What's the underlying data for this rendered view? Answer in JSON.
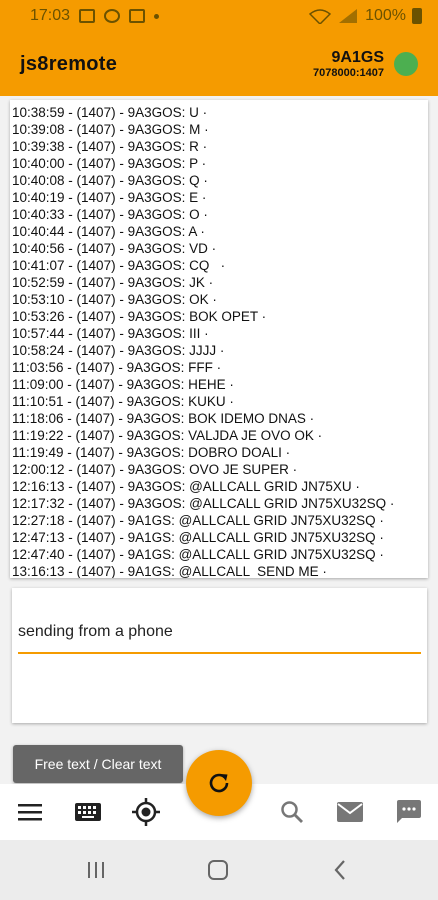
{
  "status_bar": {
    "time": "17:03",
    "battery": "100%"
  },
  "app_bar": {
    "title": "js8remote",
    "callsign": "9A1GS",
    "frequency": "7078000:1407"
  },
  "log": [
    "10:38:59 - (1407) - 9A3GOS: U ·",
    "10:39:08 - (1407) - 9A3GOS: M ·",
    "10:39:38 - (1407) - 9A3GOS: R ·",
    "10:40:00 - (1407) - 9A3GOS: P ·",
    "10:40:08 - (1407) - 9A3GOS: Q ·",
    "10:40:19 - (1407) - 9A3GOS: E ·",
    "10:40:33 - (1407) - 9A3GOS: O ·",
    "10:40:44 - (1407) - 9A3GOS: A ·",
    "10:40:56 - (1407) - 9A3GOS: VD ·",
    "10:41:07 - (1407) - 9A3GOS: CQ   ·",
    "10:52:59 - (1407) - 9A3GOS: JK ·",
    "10:53:10 - (1407) - 9A3GOS: OK ·",
    "10:53:26 - (1407) - 9A3GOS: BOK OPET ·",
    "10:57:44 - (1407) - 9A3GOS: III ·",
    "10:58:24 - (1407) - 9A3GOS: JJJJ ·",
    "11:03:56 - (1407) - 9A3GOS: FFF ·",
    "11:09:00 - (1407) - 9A3GOS: HEHE ·",
    "11:10:51 - (1407) - 9A3GOS: KUKU ·",
    "11:18:06 - (1407) - 9A3GOS: BOK IDEMO DNAS ·",
    "11:19:22 - (1407) - 9A3GOS: VALJDA JE OVO OK ·",
    "11:19:49 - (1407) - 9A3GOS: DOBRO DOALI ·",
    "12:00:12 - (1407) - 9A3GOS: OVO JE SUPER ·",
    "12:16:13 - (1407) - 9A3GOS: @ALLCALL GRID JN75XU ·",
    "12:17:32 - (1407) - 9A3GOS: @ALLCALL GRID JN75XU32SQ ·",
    "12:27:18 - (1407) - 9A1GS: @ALLCALL GRID JN75XU32SQ ·",
    "12:47:13 - (1407) - 9A1GS: @ALLCALL GRID JN75XU32SQ ·",
    "12:47:40 - (1407) - 9A1GS: @ALLCALL GRID JN75XU32SQ ·",
    "13:16:13 - (1407) - 9A1GS: @ALLCALL  SEND ME ·"
  ],
  "input": {
    "value": "sending from a phone"
  },
  "buttons": {
    "free_text": "Free text / Clear text"
  },
  "colors": {
    "accent": "#f59b00",
    "status_online": "#4caf50",
    "button_gray": "#666666"
  },
  "icons": {
    "fab": "refresh-icon",
    "bottom_nav": [
      "menu-icon",
      "keyboard-icon",
      "gps-target-icon",
      "search-icon",
      "mail-icon",
      "chat-icon"
    ],
    "system_nav": [
      "recent-apps-icon",
      "home-icon",
      "back-icon"
    ]
  }
}
